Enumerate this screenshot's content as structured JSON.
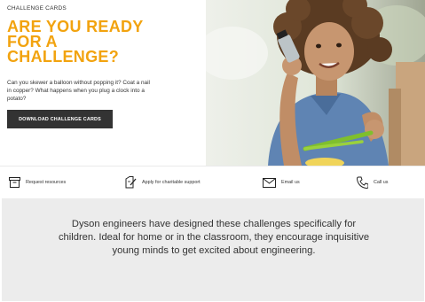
{
  "hero": {
    "eyebrow": "CHALLENGE CARDS",
    "headline_lines": [
      "ARE YOU READY",
      "FOR A",
      "CHALLENGE?"
    ],
    "intro": "Can you skewer a balloon without popping it? Coat a nail in copper? What happens when you plug a clock into a potato?",
    "cta_label": "DOWNLOAD CHALLENGE CARDS",
    "accent_color": "#f2a30f",
    "cta_color": "#333333"
  },
  "util_bar": {
    "items": [
      {
        "label": "Request resources",
        "icon": "box-icon"
      },
      {
        "label": "Apply for charitable support",
        "icon": "document-pen-icon"
      },
      {
        "label": "Email us",
        "icon": "envelope-icon"
      },
      {
        "label": "Call us",
        "icon": "phone-icon"
      }
    ]
  },
  "description": {
    "text": "Dyson engineers have designed these challenges specifically for children. Ideal for home or in the classroom, they encourage inquisitive young minds to get excited about engineering."
  }
}
